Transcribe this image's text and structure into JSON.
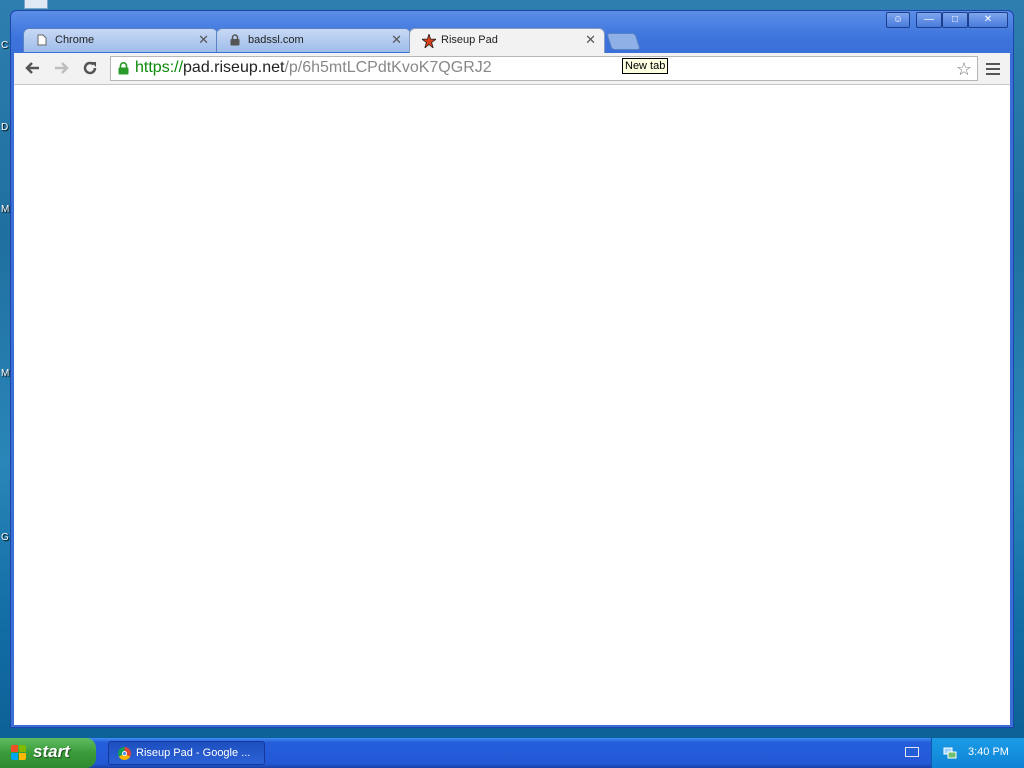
{
  "desktop": {
    "letters": [
      "C",
      "D",
      "M",
      "M",
      "G"
    ]
  },
  "window": {
    "tabs": [
      {
        "label": "Chrome",
        "icon": "page-icon"
      },
      {
        "label": "badssl.com",
        "icon": "lock-icon"
      },
      {
        "label": "Riseup Pad",
        "icon": "riseup-star-icon",
        "active": true
      }
    ],
    "tooltip": "New tab",
    "omnibox": {
      "scheme": "https://",
      "host": "pad.riseup.net",
      "path": "/p/6h5mtLCPdtKvoK7QGRJ2"
    }
  },
  "taskbar": {
    "start_label": "start",
    "task_label": "Riseup Pad - Google ...",
    "clock": "3:40 PM"
  },
  "colors": {
    "titlebar": "#3a6fd8",
    "start_green": "#3a9b3a",
    "secure_green": "#0a8a0a"
  }
}
